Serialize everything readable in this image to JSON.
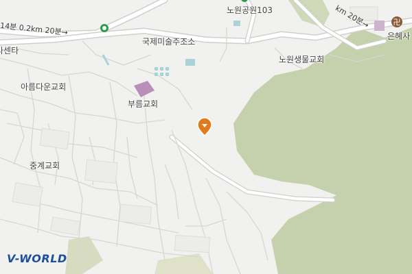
{
  "map": {
    "labels": {
      "gukje": "국제미술주조소",
      "nowon_saengmul": "노원생물교회",
      "areumdaun": "아름다운교회",
      "bureum": "부름교회",
      "junggye": "중계교회",
      "senta": "사센타",
      "station": "노원공원103",
      "eunhye": "은혜사"
    },
    "route_labels": {
      "left": "14분 0.2km 20분→",
      "right": "km 20분→"
    },
    "logo": "V-WORLD",
    "colors": {
      "background": "#f1f1ef",
      "forest": "#c6d2ad",
      "road": "#ffffff",
      "road_outline": "#d2d2cf",
      "building": "#b68ab6",
      "water": "#a9d4d6",
      "marker": "#e07a1b",
      "transit_green": "#2e9a4a"
    }
  }
}
